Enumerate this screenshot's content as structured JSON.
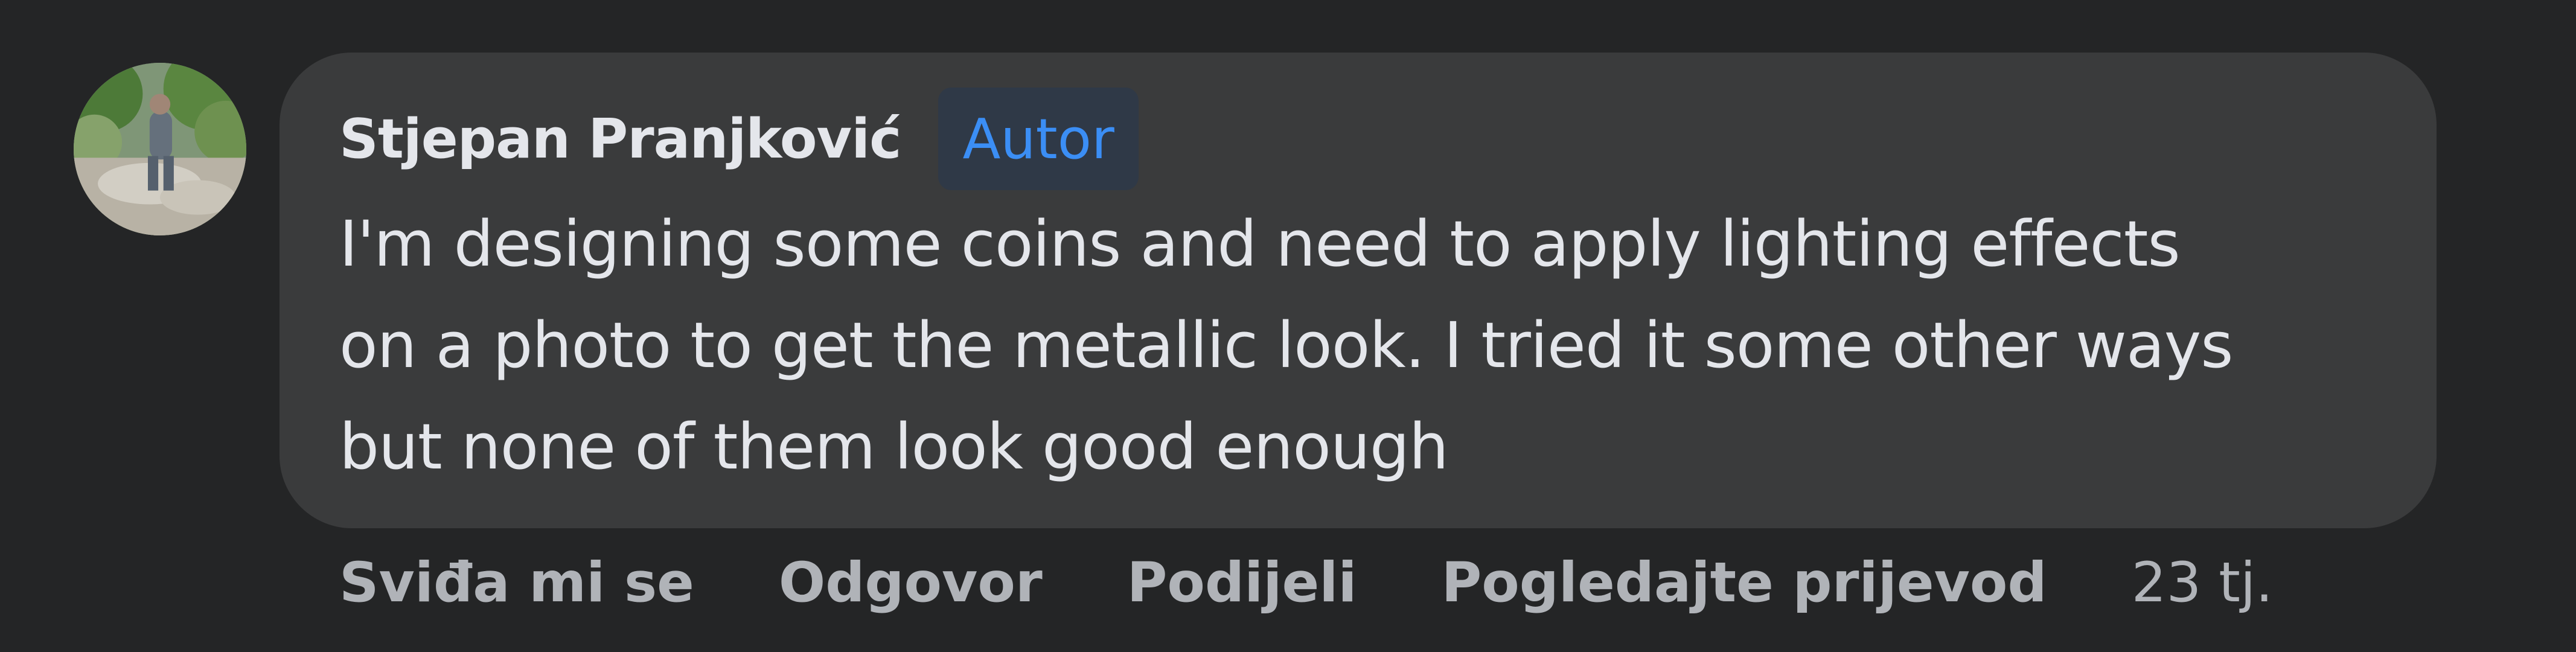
{
  "comment": {
    "author": "Stjepan Pranjković",
    "badge": "Autor",
    "text_lines": [
      "I'm designing some coins and need to apply lighting effects",
      "on a photo to get the metallic look. I tried it some other ways",
      "but none of them look good enough"
    ],
    "avatar_icon": "profile-photo-icon"
  },
  "actions": {
    "like": "Sviđa mi se",
    "reply": "Odgovor",
    "share": "Podijeli",
    "translate": "Pogledajte prijevod",
    "timestamp": "23 tj."
  },
  "colors": {
    "background": "#242526",
    "bubble": "#3a3b3c",
    "badge_text": "#3b8ef5",
    "secondary_text": "#b0b3b8"
  }
}
